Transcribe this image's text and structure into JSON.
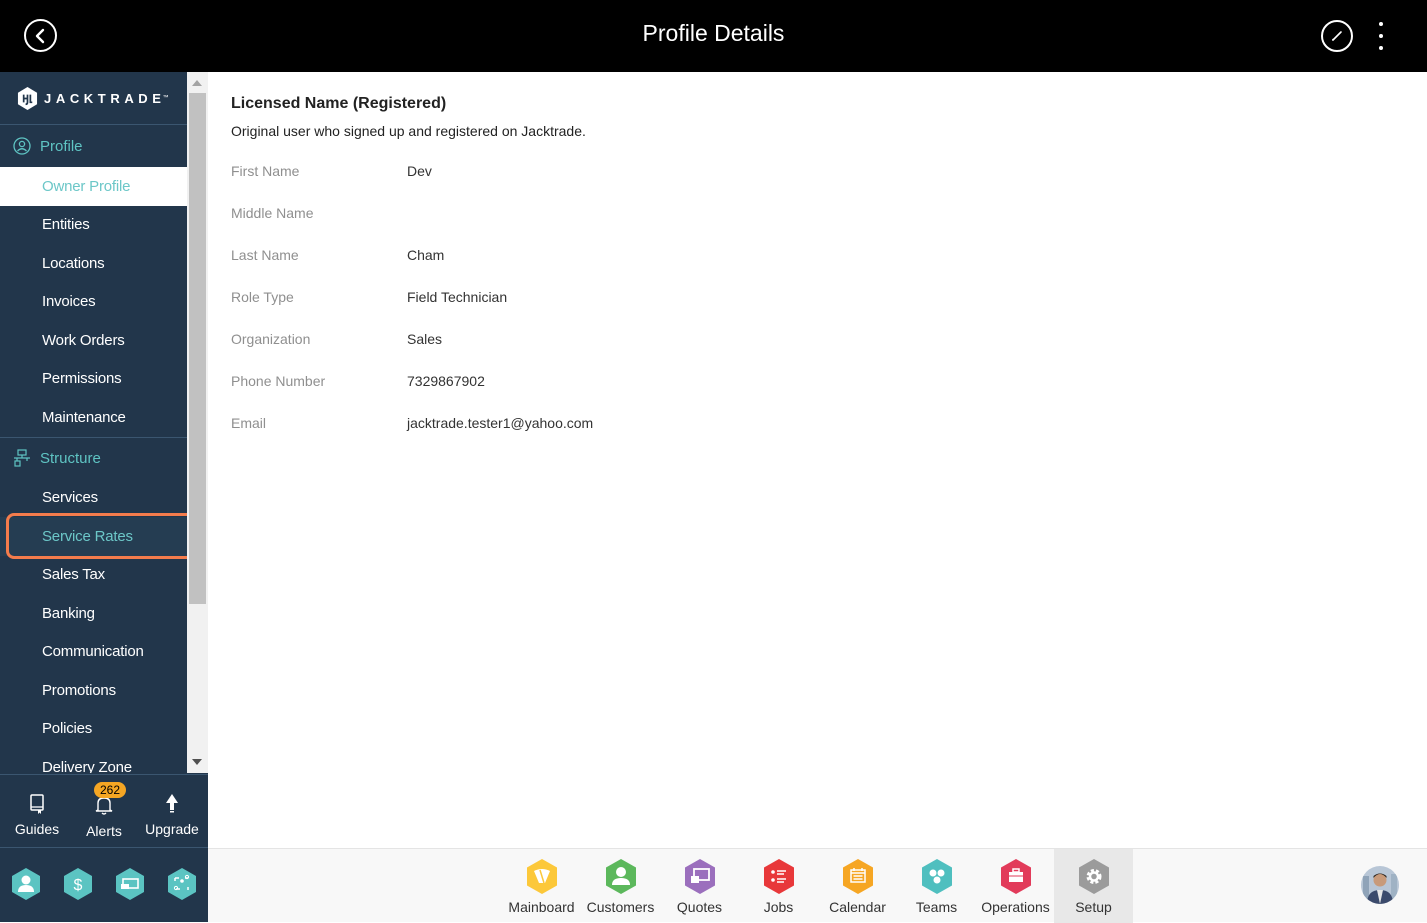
{
  "header": {
    "title": "Profile Details",
    "back_icon": "back-arrow-circle-icon",
    "edit_icon": "pencil-edit-icon",
    "more_icon": "vertical-ellipsis-icon"
  },
  "brand": {
    "name": "JACKTRADE",
    "tm": "™"
  },
  "sidebar": {
    "sections": [
      {
        "label": "Profile",
        "icon": "user-circle-icon",
        "items": [
          {
            "label": "Owner Profile",
            "state": "active"
          },
          {
            "label": "Entities"
          },
          {
            "label": "Locations"
          },
          {
            "label": "Invoices"
          },
          {
            "label": "Work Orders"
          },
          {
            "label": "Permissions"
          },
          {
            "label": "Maintenance"
          }
        ]
      },
      {
        "label": "Structure",
        "icon": "org-structure-icon",
        "items": [
          {
            "label": "Services"
          },
          {
            "label": "Service Rates",
            "state": "highlighted"
          },
          {
            "label": "Sales Tax"
          },
          {
            "label": "Banking"
          },
          {
            "label": "Communication"
          },
          {
            "label": "Promotions"
          },
          {
            "label": "Policies"
          },
          {
            "label": "Delivery Zone"
          }
        ]
      }
    ],
    "utility": [
      {
        "label": "Guides",
        "icon": "book-icon"
      },
      {
        "label": "Alerts",
        "icon": "bell-icon",
        "badge": "262"
      },
      {
        "label": "Upgrade",
        "icon": "arrow-up-icon"
      }
    ],
    "quick_actions": [
      {
        "icon": "person-hex-icon"
      },
      {
        "icon": "dollar-hex-icon"
      },
      {
        "icon": "money-hex-icon"
      },
      {
        "icon": "workflow-hex-icon"
      }
    ]
  },
  "content": {
    "title": "Licensed Name (Registered)",
    "subtitle": "Original user who signed up and registered on Jacktrade.",
    "fields": [
      {
        "label": "First Name",
        "value": "Dev"
      },
      {
        "label": "Middle Name",
        "value": ""
      },
      {
        "label": "Last Name",
        "value": "Cham"
      },
      {
        "label": "Role Type",
        "value": "Field Technician"
      },
      {
        "label": "Organization",
        "value": "Sales"
      },
      {
        "label": "Phone Number",
        "value": "7329867902"
      },
      {
        "label": "Email",
        "value": "jacktrade.tester1@yahoo.com"
      }
    ]
  },
  "apps": [
    {
      "label": "Mainboard",
      "color": "#fcc83a",
      "icon": "mainboard-icon"
    },
    {
      "label": "Customers",
      "color": "#5cb85c",
      "icon": "customer-icon"
    },
    {
      "label": "Quotes",
      "color": "#9b6fbd",
      "icon": "quotes-icon"
    },
    {
      "label": "Jobs",
      "color": "#e8383a",
      "icon": "jobs-list-icon"
    },
    {
      "label": "Calendar",
      "color": "#f6a623",
      "icon": "calendar-icon"
    },
    {
      "label": "Teams",
      "color": "#4fbfbf",
      "icon": "teams-icon"
    },
    {
      "label": "Operations",
      "color": "#e23b5a",
      "icon": "briefcase-icon"
    },
    {
      "label": "Setup",
      "color": "#9b9b9b",
      "icon": "gear-icon",
      "current": true
    }
  ],
  "colors": {
    "accent": "#5fc4c3",
    "sidebar_bg": "#22364b",
    "highlight_border": "#f47c4c",
    "badge": "#f5a623"
  }
}
